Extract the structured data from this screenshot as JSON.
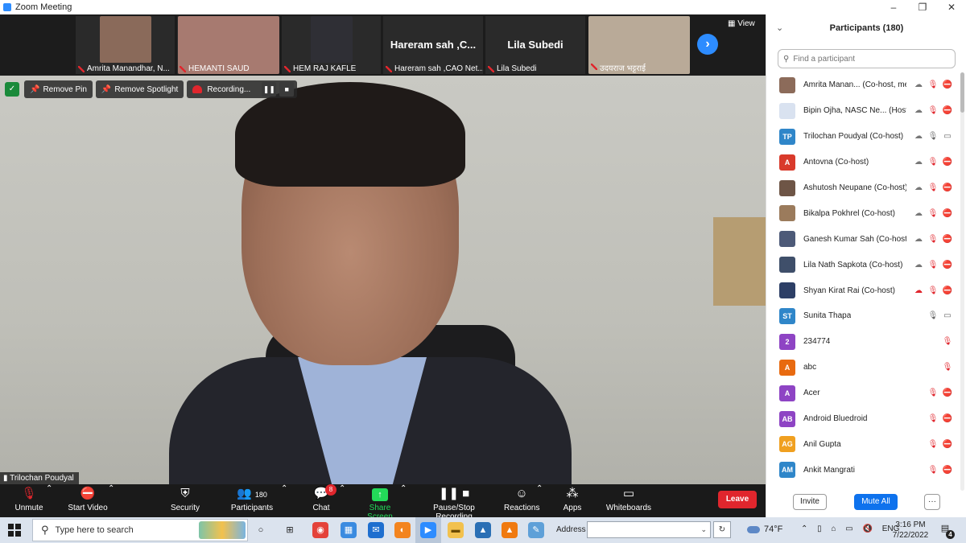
{
  "window": {
    "title": "Zoom Meeting",
    "controls": [
      "–",
      "❐",
      "✕"
    ]
  },
  "gallery": {
    "tiles": [
      {
        "name": "Amrita Manandhar, N...",
        "type": "photo",
        "color": "#8a6a5a"
      },
      {
        "name": "HEMANTI SAUD",
        "type": "photo",
        "color": "#a77a70"
      },
      {
        "name": "HEM RAJ KAFLE",
        "type": "photo",
        "color": "#2f2f35"
      },
      {
        "name": "Hareram sah ,CAO Net...",
        "type": "text",
        "big": "Hareram sah ,C..."
      },
      {
        "name": "Lila Subedi",
        "type": "text",
        "big": "Lila Subedi"
      },
      {
        "name": "उदयराज भट्टराई",
        "type": "photo",
        "color": "#b9aa98"
      }
    ],
    "next_icon": "›",
    "view_label": "View"
  },
  "main": {
    "remove_pin": "Remove Pin",
    "remove_spotlight": "Remove Spotlight",
    "recording": "Recording...",
    "pause_icon": "❚❚",
    "stop_icon": "■",
    "speaker": "Trilochan Poudyal"
  },
  "toolbar": {
    "unmute": "Unmute",
    "start_video": "Start Video",
    "security": "Security",
    "participants": "Participants",
    "participants_count": "180",
    "chat": "Chat",
    "chat_badge": "8",
    "share_screen": "Share Screen",
    "recording": "Pause/Stop Recording",
    "reactions": "Reactions",
    "apps": "Apps",
    "whiteboards": "Whiteboards",
    "leave": "Leave"
  },
  "panel": {
    "title": "Participants (180)",
    "search_placeholder": "Find a participant",
    "participants": [
      {
        "name": "Amrita Manan... (Co-host, me)",
        "avatar": "",
        "color": "#8c6b5a",
        "icons": [
          "rec",
          "mute",
          "vidoff"
        ]
      },
      {
        "name": "Bipin Ojha, NASC Ne...  (Host)",
        "avatar": "",
        "color": "#d9e2f0",
        "icons": [
          "rec",
          "mute",
          "vidoff"
        ]
      },
      {
        "name": "Trilochan Poudyal (Co-host)",
        "avatar": "TP",
        "color": "#2f86c9",
        "icons": [
          "rec",
          "mic",
          "vid"
        ]
      },
      {
        "name": "Antovna (Co-host)",
        "avatar": "A",
        "color": "#d93a2b",
        "icons": [
          "rec",
          "mute",
          "vidoff"
        ]
      },
      {
        "name": "Ashutosh Neupane (Co-host)",
        "avatar": "",
        "color": "#6e5546",
        "icons": [
          "rec",
          "mute",
          "vidoff"
        ]
      },
      {
        "name": "Bikalpa Pokhrel (Co-host)",
        "avatar": "",
        "color": "#9b7b5c",
        "icons": [
          "rec",
          "mute",
          "vidoff"
        ]
      },
      {
        "name": "Ganesh Kumar Sah (Co-host)",
        "avatar": "",
        "color": "#4d5a78",
        "icons": [
          "rec",
          "mute",
          "vidoff"
        ]
      },
      {
        "name": "Lila Nath Sapkota (Co-host)",
        "avatar": "",
        "color": "#3f4f6a",
        "icons": [
          "rec",
          "mute",
          "vidoff"
        ]
      },
      {
        "name": "Shyan Kirat Rai (Co-host)",
        "avatar": "",
        "color": "#2d3f66",
        "icons": [
          "recon",
          "mute",
          "vidoff"
        ]
      },
      {
        "name": "Sunita Thapa",
        "avatar": "ST",
        "color": "#2f86c9",
        "icons": [
          "mic",
          "vid"
        ]
      },
      {
        "name": "234774",
        "avatar": "2",
        "color": "#8e44c4",
        "icons": [
          "mute"
        ]
      },
      {
        "name": "abc",
        "avatar": "A",
        "color": "#e86a10",
        "icons": [
          "mute"
        ]
      },
      {
        "name": "Acer",
        "avatar": "A",
        "color": "#8e44c4",
        "icons": [
          "mute",
          "vidoff"
        ]
      },
      {
        "name": "Android Bluedroid",
        "avatar": "AB",
        "color": "#8e44c4",
        "icons": [
          "mute",
          "vidoff"
        ]
      },
      {
        "name": "Anil Gupta",
        "avatar": "AG",
        "color": "#f0a020",
        "icons": [
          "mute",
          "vidoff"
        ]
      },
      {
        "name": "Ankit Mangrati",
        "avatar": "AM",
        "color": "#2f86c9",
        "icons": [
          "mute",
          "vidoff"
        ]
      }
    ],
    "invite": "Invite",
    "mute_all": "Mute All",
    "more": "···"
  },
  "taskbar": {
    "search_placeholder": "Type here to search",
    "address_label": "Address",
    "address_caret": "⌄",
    "weather": "74°F",
    "lang": "ENG",
    "time": "3:16 PM",
    "date": "7/22/2022",
    "notif_count": "4",
    "apps": [
      {
        "name": "task-view-icon",
        "glyph": "○",
        "color": "#dbe3ee",
        "fg": "#222"
      },
      {
        "name": "widgets-icon",
        "glyph": "⊞",
        "color": "#dbe3ee",
        "fg": "#222"
      },
      {
        "name": "chrome-icon",
        "glyph": "◉",
        "color": "#e4423a",
        "fg": "#fff"
      },
      {
        "name": "store-icon",
        "glyph": "▦",
        "color": "#3b8be0",
        "fg": "#fff"
      },
      {
        "name": "mail-icon",
        "glyph": "✉",
        "color": "#1f6fcf",
        "fg": "#fff"
      },
      {
        "name": "firefox-icon",
        "glyph": "◐",
        "color": "#f3841f",
        "fg": "#fff"
      },
      {
        "name": "zoom-icon",
        "glyph": "▶",
        "color": "#2d8cff",
        "fg": "#fff"
      },
      {
        "name": "explorer-icon",
        "glyph": "▬",
        "color": "#f2c14e",
        "fg": "#6b4a00"
      },
      {
        "name": "photos-icon",
        "glyph": "▲",
        "color": "#2a6fb5",
        "fg": "#fff"
      },
      {
        "name": "vlc-icon",
        "glyph": "▲",
        "color": "#f07a10",
        "fg": "#fff"
      },
      {
        "name": "paint-icon",
        "glyph": "✎",
        "color": "#5ea0d8",
        "fg": "#fff"
      }
    ]
  }
}
